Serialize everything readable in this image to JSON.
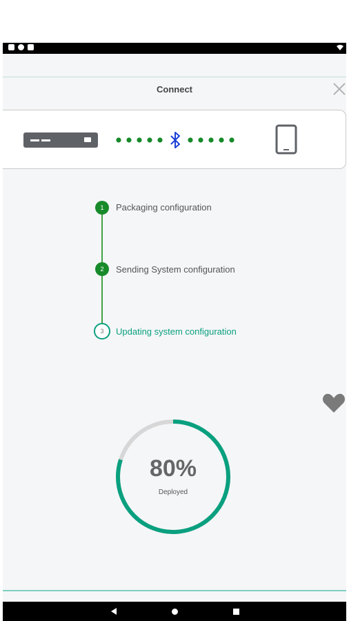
{
  "header": {
    "title": "Connect"
  },
  "steps": [
    {
      "number": "1",
      "label": "Packaging configuration",
      "status": "done"
    },
    {
      "number": "2",
      "label": "Sending System configuration",
      "status": "done"
    },
    {
      "number": "3",
      "label": "Updating system configuration",
      "status": "current"
    }
  ],
  "progress": {
    "value_label": "80%",
    "value": 0.8,
    "caption": "Deployed"
  },
  "colors": {
    "accent": "#0aa07f",
    "done": "#178a2a",
    "bluetooth": "#1a3fd6",
    "dots": "#178a2a"
  },
  "icons": [
    "server-icon",
    "bluetooth-icon",
    "tablet-icon",
    "close-icon",
    "heart-icon"
  ]
}
